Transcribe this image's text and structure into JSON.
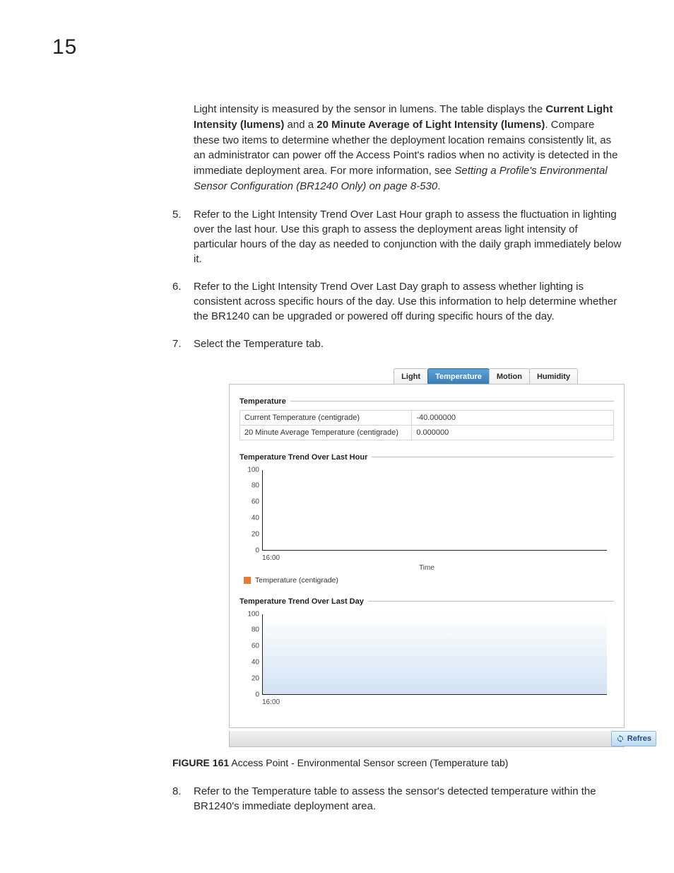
{
  "page_number": "15",
  "intro_paragraph": {
    "pre1": "Light intensity is measured by the sensor in lumens. The table displays the ",
    "bold1": "Current Light Intensity (lumens)",
    "mid1": " and a ",
    "bold2": "20 Minute Average of Light Intensity (lumens)",
    "post1": ". Compare these two items to determine whether the deployment location remains consistently lit, as an administrator can power off the Access Point's radios when no activity is detected in the immediate deployment area. For more information, see ",
    "italic1": "Setting a Profile's Environmental Sensor Configuration (BR1240 Only) on page 8-530",
    "end": "."
  },
  "steps": {
    "s5": {
      "num": "5.",
      "pre": "Refer to the ",
      "bold": "Light Intensity Trend Over Last Hour",
      "post": " graph to assess the fluctuation in lighting over the last hour. Use this graph to assess the deployment areas light intensity of particular hours of the day as needed to conjunction with the daily graph immediately below it."
    },
    "s6": {
      "num": "6.",
      "pre": "Refer to the ",
      "bold": "Light Intensity Trend Over Last Day",
      "post": " graph to assess whether lighting is consistent across specific hours of the day. Use this information to help determine whether the BR1240 can be upgraded or powered off during specific hours of the day."
    },
    "s7": {
      "num": "7.",
      "pre": "Select the ",
      "bold": "Temperature",
      "post": " tab."
    },
    "s8": {
      "num": "8.",
      "pre": "Refer to the ",
      "bold": "Temperature",
      "post": " table to assess the sensor's detected temperature within the BR1240's immediate deployment area."
    }
  },
  "tabs": {
    "light": "Light",
    "temperature": "Temperature",
    "motion": "Motion",
    "humidity": "Humidity"
  },
  "panel": {
    "section_temp_title": "Temperature",
    "rows": [
      {
        "label": "Current Temperature (centigrade)",
        "value": "-40.000000"
      },
      {
        "label": "20 Minute Average Temperature (centigrade)",
        "value": "0.000000"
      }
    ],
    "trend_hour_title": "Temperature Trend Over Last Hour",
    "trend_day_title": "Temperature Trend Over Last Day",
    "legend_label": "Temperature (centigrade)",
    "x_axis_label": "Time",
    "x_tick": "16:00",
    "y_ticks": [
      "0",
      "20",
      "40",
      "60",
      "80",
      "100"
    ],
    "refresh_label": "Refres"
  },
  "figure_caption": {
    "label": "FIGURE 161",
    "text": "  Access Point - Environmental Sensor screen (Temperature tab)"
  },
  "chart_data": [
    {
      "type": "line",
      "title": "Temperature Trend Over Last Hour",
      "xlabel": "Time",
      "ylabel": "",
      "ylim": [
        0,
        100
      ],
      "x": [
        "16:00"
      ],
      "series": [
        {
          "name": "Temperature (centigrade)",
          "values": []
        }
      ]
    },
    {
      "type": "line",
      "title": "Temperature Trend Over Last Day",
      "xlabel": "",
      "ylabel": "",
      "ylim": [
        0,
        100
      ],
      "x": [
        "16:00"
      ],
      "series": [
        {
          "name": "Temperature (centigrade)",
          "values": []
        }
      ]
    }
  ]
}
